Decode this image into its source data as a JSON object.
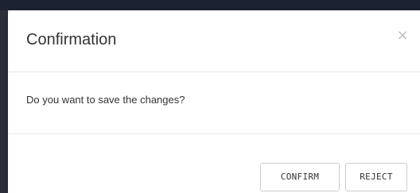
{
  "dialog": {
    "title": "Confirmation",
    "close_symbol": "×",
    "message": "Do you want to save the changes?",
    "confirm_label": "CONFIRM",
    "reject_label": "REJECT"
  },
  "icons": {
    "close": "close-icon"
  },
  "colors": {
    "backdrop": "#1c2231",
    "text": "#333333",
    "divider": "#e5e5e5",
    "button_border": "#cccccc"
  }
}
